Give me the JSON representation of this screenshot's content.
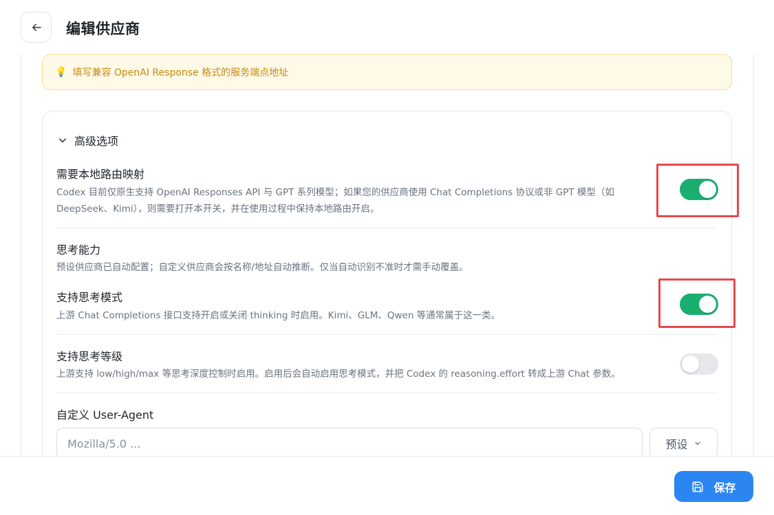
{
  "header": {
    "back_icon": "arrow-left-icon",
    "title": "编辑供应商"
  },
  "hint": {
    "icon": "lightbulb-icon",
    "text": "填写兼容 OpenAI Response 格式的服务端点地址"
  },
  "advanced": {
    "title": "高级选项",
    "local_route": {
      "title": "需要本地路由映射",
      "desc_line1": "Codex 目前仅原生支持 OpenAI Responses API 与 GPT 系列模型；如果您的供应商使用 Chat Completions 协议或非 GPT 模型（如",
      "desc_line2": "DeepSeek、Kimi），则需要打开本开关，并在使用过程中保持本地路由开启。",
      "enabled": true
    },
    "thinking": {
      "title": "思考能力",
      "desc": "预设供应商已自动配置；自定义供应商会按名称/地址自动推断。仅当自动识别不准时才需手动覆盖。"
    },
    "thinking_mode": {
      "title": "支持思考模式",
      "desc": "上游 Chat Completions 接口支持开启或关闭 thinking 时启用。Kimi、GLM、Qwen 等通常属于这一类。",
      "enabled": true
    },
    "thinking_level": {
      "title": "支持思考等级",
      "desc": "上游支持 low/high/max 等思考深度控制时启用。启用后会自动启用思考模式，并把 Codex 的 reasoning.effort 转成上游 Chat 参数。",
      "enabled": false
    },
    "user_agent": {
      "label": "自定义 User-Agent",
      "placeholder": "Mozilla/5.0 ...",
      "value": "",
      "preset_label": "预设"
    }
  },
  "footer": {
    "save_label": "保存"
  },
  "colors": {
    "toggle_on": "#1aae6f",
    "toggle_off": "#e6e7ea",
    "primary": "#2b86f2",
    "highlight": "#e5484d",
    "hint_text": "#c98a0a",
    "hint_bg": "#fff9e8"
  }
}
